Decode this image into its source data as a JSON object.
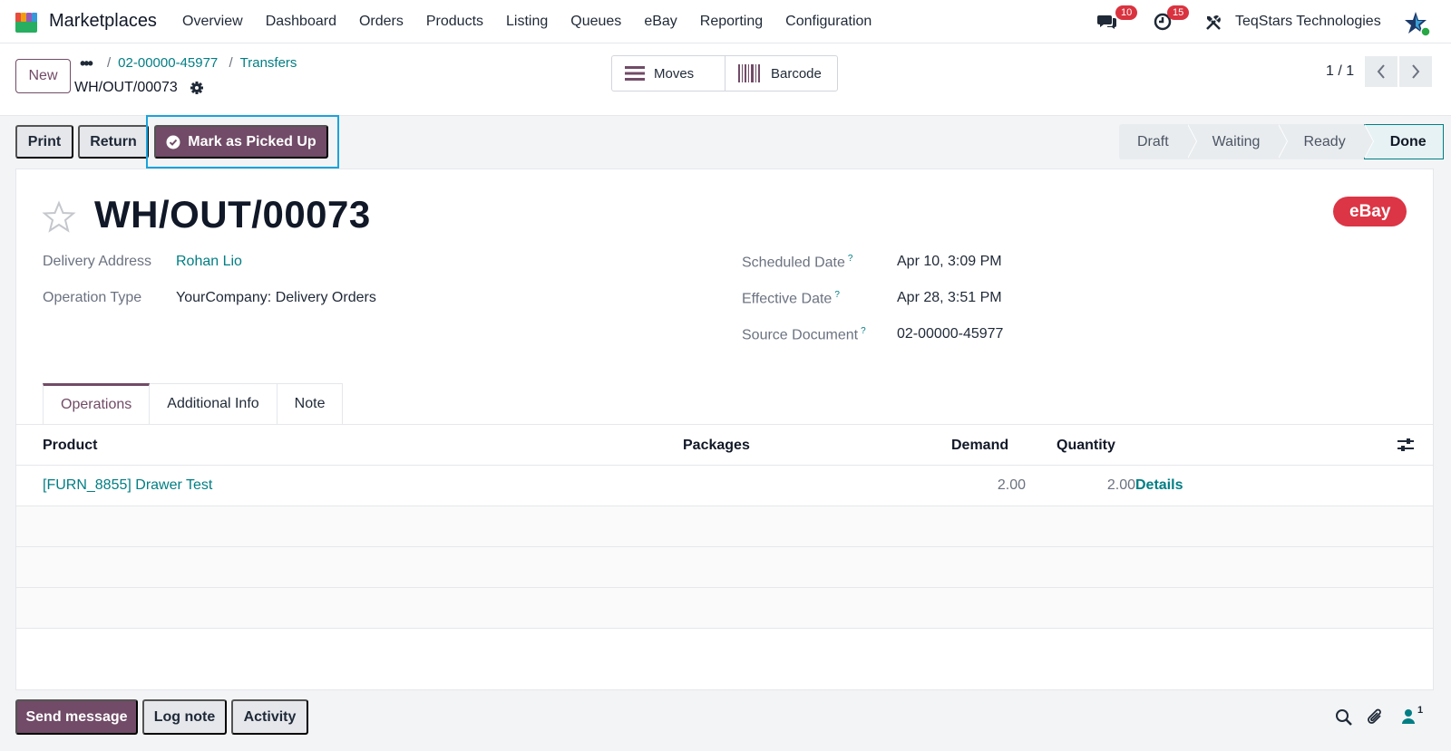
{
  "app": {
    "name": "Marketplaces",
    "menu": [
      "Overview",
      "Dashboard",
      "Orders",
      "Products",
      "Listing",
      "Queues",
      "eBay",
      "Reporting",
      "Configuration"
    ],
    "messages_badge": "10",
    "activities_badge": "15",
    "company": "TeqStars Technologies"
  },
  "control": {
    "new_label": "New",
    "breadcrumbs": [
      "02-00000-45977",
      "Transfers"
    ],
    "record_name": "WH/OUT/00073",
    "smart_buttons": {
      "moves": "Moves",
      "barcode": "Barcode"
    },
    "pager": "1 / 1"
  },
  "actions": {
    "print": "Print",
    "return": "Return",
    "mark_picked_up": "Mark as Picked Up"
  },
  "statusbar": {
    "stages": [
      "Draft",
      "Waiting",
      "Ready",
      "Done"
    ],
    "current": "Done"
  },
  "form": {
    "title": "WH/OUT/00073",
    "tag": "eBay",
    "fields": {
      "delivery_address_label": "Delivery Address",
      "delivery_address": "Rohan Lio",
      "operation_type_label": "Operation Type",
      "operation_type": "YourCompany: Delivery Orders",
      "scheduled_date_label": "Scheduled Date",
      "scheduled_date": "Apr 10, 3:09 PM",
      "effective_date_label": "Effective Date",
      "effective_date": "Apr 28, 3:51 PM",
      "source_document_label": "Source Document",
      "source_document": "02-00000-45977",
      "help_mark": "?"
    },
    "tabs": [
      "Operations",
      "Additional Info",
      "Note"
    ],
    "table": {
      "headers": {
        "product": "Product",
        "packages": "Packages",
        "demand": "Demand",
        "quantity": "Quantity"
      },
      "rows": [
        {
          "product": "[FURN_8855] Drawer Test",
          "packages": "",
          "demand": "2.00",
          "quantity": "2.00",
          "action": "Details"
        }
      ]
    }
  },
  "chatter": {
    "send_message": "Send message",
    "log_note": "Log note",
    "activity": "Activity",
    "followers_count": "1"
  },
  "colors": {
    "brand": "#714b67",
    "link": "#017e84",
    "badge": "#d9333f",
    "ebay_tag": "#dc3545",
    "highlight": "#1aa3dc"
  }
}
